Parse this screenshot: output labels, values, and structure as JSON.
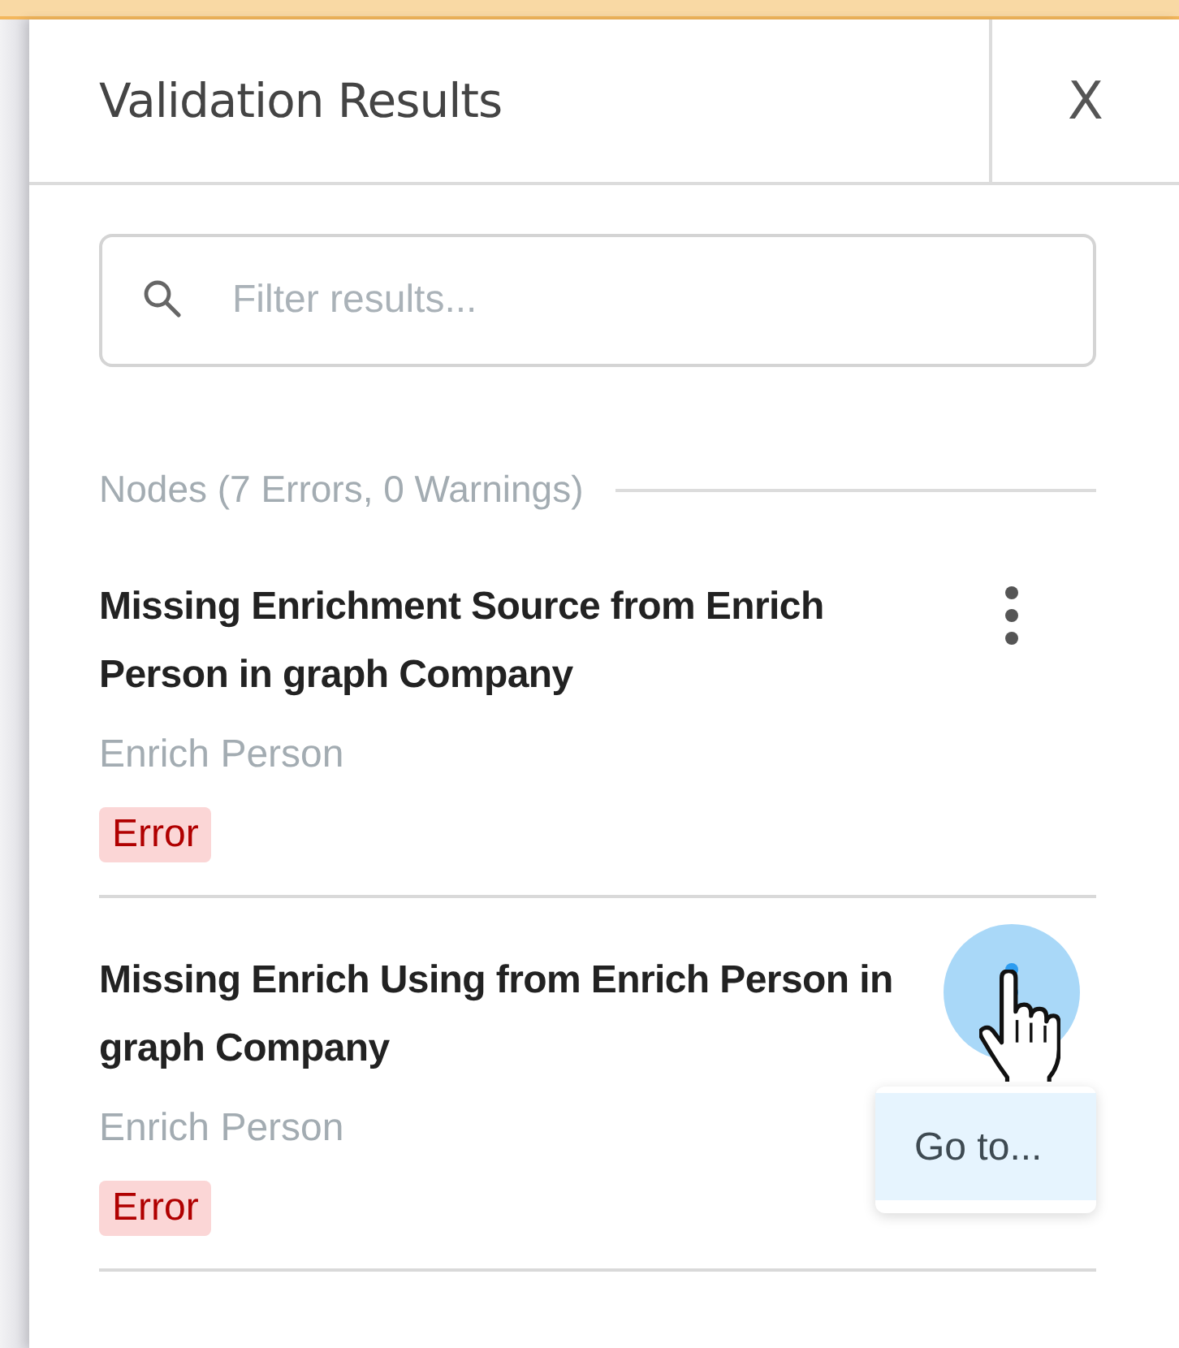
{
  "panel": {
    "title": "Validation Results",
    "close": "X"
  },
  "search": {
    "placeholder": "Filter results..."
  },
  "section": {
    "heading": "Nodes (7 Errors, 0 Warnings)"
  },
  "results": [
    {
      "title": "Missing Enrichment Source from Enrich Person in graph Company",
      "node": "Enrich Person",
      "badge": "Error",
      "menu_open": false
    },
    {
      "title": "Missing Enrich Using from Enrich Person in graph Company",
      "node": "Enrich Person",
      "badge": "Error",
      "menu_open": true,
      "menu_items": [
        "Go to..."
      ]
    }
  ]
}
